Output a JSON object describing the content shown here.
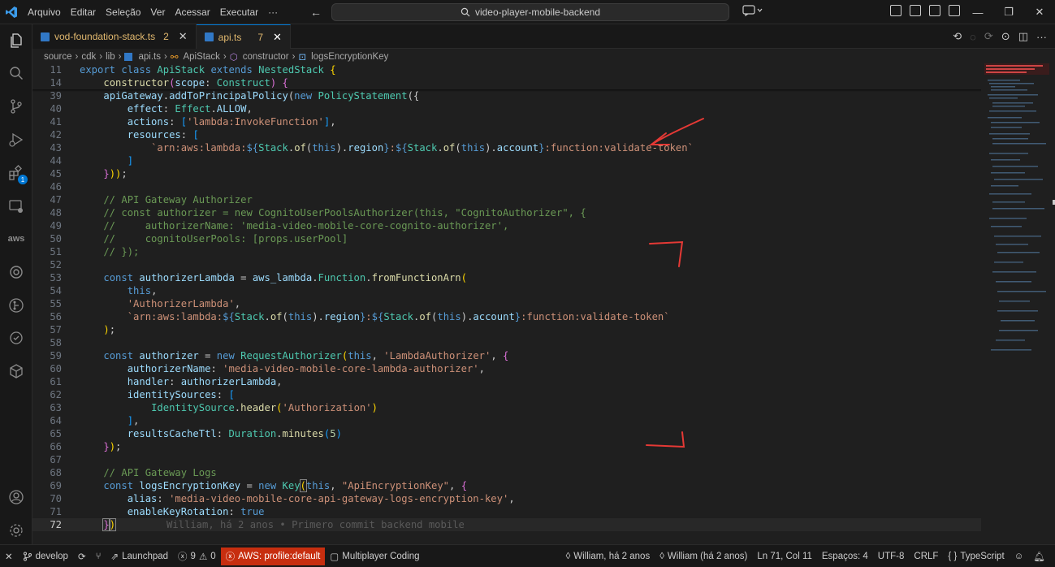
{
  "menu": [
    "Arquivo",
    "Editar",
    "Seleção",
    "Ver",
    "Acessar",
    "Executar",
    "···"
  ],
  "search": {
    "text": "video-player-mobile-backend"
  },
  "tabs": [
    {
      "label": "vod-foundation-stack.ts",
      "count": "2",
      "active": false
    },
    {
      "label": "api.ts",
      "count": "7",
      "active": true
    }
  ],
  "breadcrumb": {
    "parts": [
      "source",
      "cdk",
      "lib"
    ],
    "file": "api.ts",
    "class": "ApiStack",
    "method": "constructor",
    "symbol": "logsEncryptionKey"
  },
  "activity_badges": {
    "extensions": "1"
  },
  "editor": {
    "sticky_lines": [
      {
        "n": "11",
        "text": "export class ApiStack extends NestedStack {"
      },
      {
        "n": "14",
        "text": "    constructor(scope: Construct) {"
      }
    ],
    "line_numbers": [
      "39",
      "40",
      "41",
      "42",
      "43",
      "44",
      "45",
      "46",
      "47",
      "48",
      "49",
      "50",
      "51",
      "52",
      "53",
      "54",
      "55",
      "56",
      "57",
      "58",
      "59",
      "60",
      "61",
      "62",
      "63",
      "64",
      "65",
      "66",
      "67",
      "68",
      "69",
      "70",
      "71",
      "72"
    ],
    "blame": "William, há 2 anos • Primero commit backend mobile"
  },
  "status": {
    "branch": "develop",
    "problems_errors": "9",
    "problems_warnings": "0",
    "launchpad": "Launchpad",
    "aws_profile": "AWS: profile:default",
    "multiplayer": "Multiplayer Coding",
    "blame_author": "William, há 2 anos",
    "blame_author_full": "William (há 2 anos)",
    "cursor": "Ln 71, Col 11",
    "spaces": "Espaços: 4",
    "encoding": "UTF-8",
    "eol": "CRLF",
    "language": "TypeScript"
  },
  "colors": {
    "accent": "#0078d4",
    "aws_status": "#c72e0f",
    "annotation": "#e53935"
  }
}
